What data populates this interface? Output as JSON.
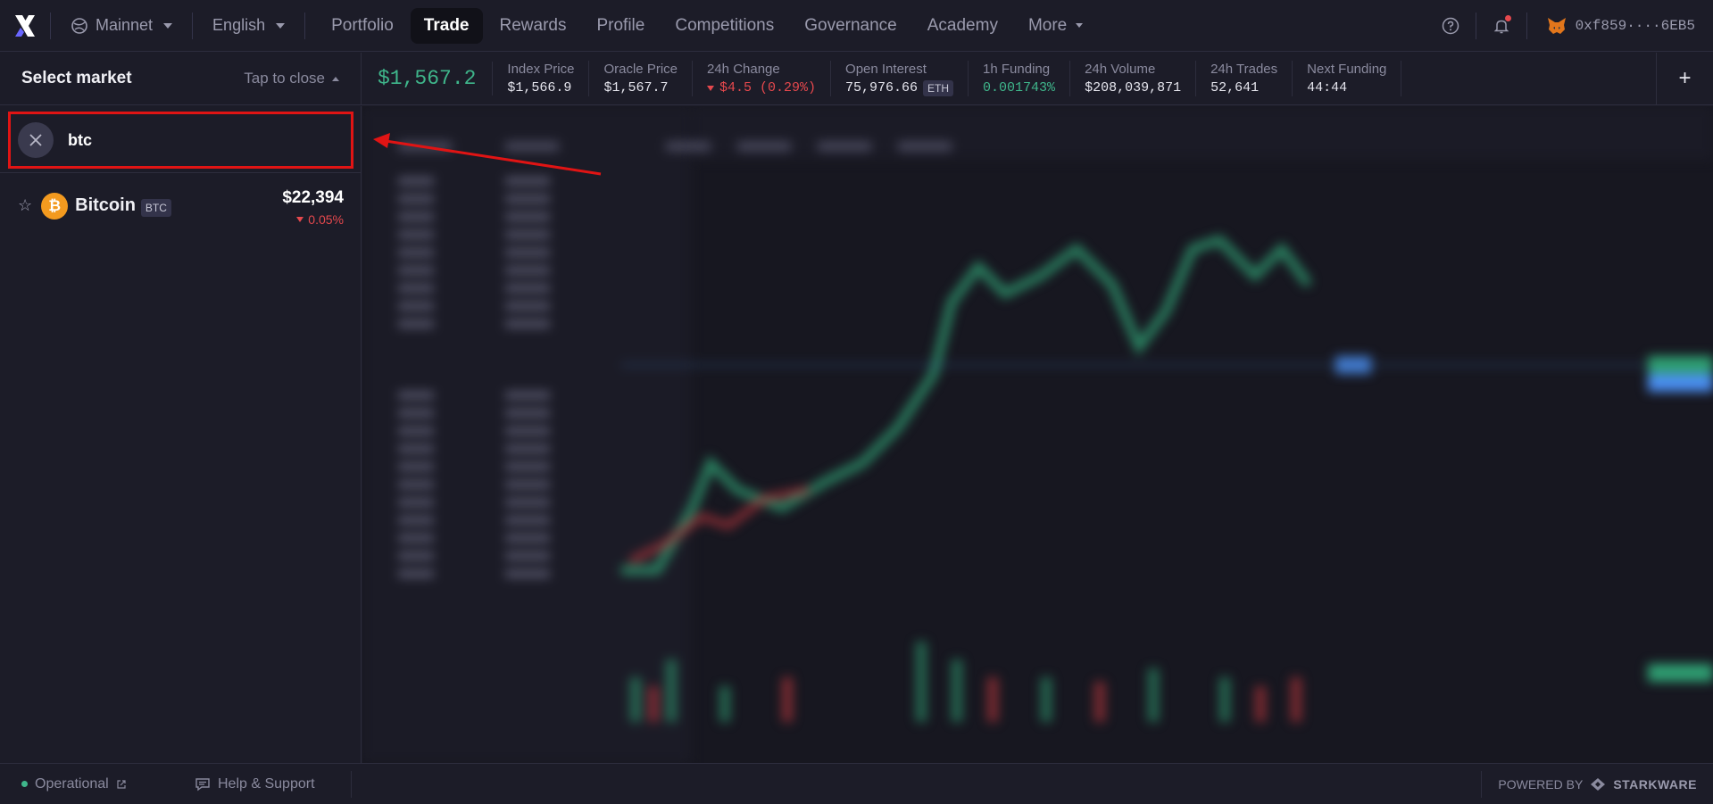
{
  "nav": {
    "network": "Mainnet",
    "language": "English",
    "links": [
      "Portfolio",
      "Trade",
      "Rewards",
      "Profile",
      "Competitions",
      "Governance",
      "Academy"
    ],
    "more": "More",
    "wallet_address": "0xf859····6EB5"
  },
  "market_bar": {
    "select_market": "Select market",
    "tap_to_close": "Tap to close",
    "price": "$1,567.2",
    "stats": {
      "index_price": {
        "label": "Index Price",
        "value": "$1,566.9"
      },
      "oracle_price": {
        "label": "Oracle Price",
        "value": "$1,567.7"
      },
      "change_24h": {
        "label": "24h Change",
        "value": "$4.5 (0.29%)"
      },
      "open_interest": {
        "label": "Open Interest",
        "value": "75,976.66",
        "unit": "ETH"
      },
      "funding_1h": {
        "label": "1h Funding",
        "value": "0.001743%"
      },
      "volume_24h": {
        "label": "24h Volume",
        "value": "$208,039,871"
      },
      "trades_24h": {
        "label": "24h Trades",
        "value": "52,641"
      },
      "next_funding": {
        "label": "Next Funding",
        "value": "44:44"
      }
    },
    "plus": "+"
  },
  "search": {
    "query": "btc"
  },
  "results": [
    {
      "name": "Bitcoin",
      "ticker": "BTC",
      "price": "$22,394",
      "change": "0.05%"
    }
  ],
  "footer": {
    "status": "Operational",
    "help": "Help & Support",
    "powered_by": "POWERED BY",
    "brand": "STARKWARE"
  },
  "colors": {
    "accent_green": "#3fb68b",
    "accent_red": "#e5484d",
    "highlight_red": "#e01414",
    "bitcoin_orange": "#f39a1f"
  }
}
